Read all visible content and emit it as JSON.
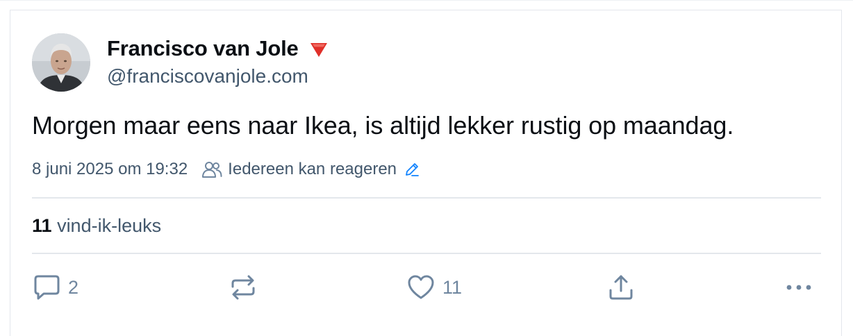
{
  "post": {
    "author_name": "Francisco van Jole",
    "author_handle": "@franciscovanjole.com",
    "text": "Morgen maar eens naar Ikea, is altijd lekker rustig op maandag.",
    "timestamp": "8 juni 2025 om 19:32",
    "reply_permission": "Iedereen kan reageren",
    "likes_count": "11",
    "likes_label": "vind-ik-leuks"
  },
  "actions": {
    "reply_count": "2",
    "like_count": "11"
  },
  "icons": {
    "badge": "red-triangle-down-icon",
    "audience": "people-icon",
    "edit": "pencil-icon",
    "reply": "speech-bubble-icon",
    "repost": "repost-icon",
    "like": "heart-icon",
    "share": "share-icon",
    "more": "ellipsis-icon"
  },
  "colors": {
    "text_primary": "#0b0f14",
    "text_secondary": "#42576c",
    "icon": "#6f869f",
    "link_blue": "#1083fe",
    "badge_red": "#e0302a"
  }
}
